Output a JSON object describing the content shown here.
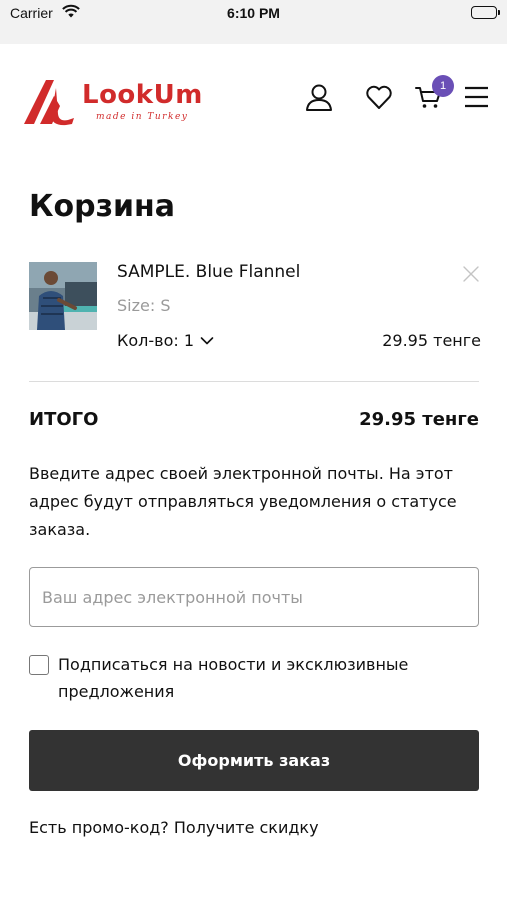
{
  "status_bar": {
    "carrier": "Carrier",
    "time": "6:10 PM"
  },
  "header": {
    "brand": "LookUm",
    "tagline": "made in Turkey",
    "brand_color": "#d12b2b",
    "cart_count": "1",
    "badge_color": "#6a4fb6",
    "icons": [
      "user-icon",
      "heart-icon",
      "cart-icon",
      "menu-icon"
    ]
  },
  "page": {
    "title": "Корзина"
  },
  "cart": {
    "items": [
      {
        "name": "SAMPLE. Blue Flannel",
        "size": "Size: S",
        "quantity": "Кол-во: 1",
        "price": "29.95 тенге"
      }
    ]
  },
  "summary": {
    "total_label": "ИТОГО",
    "total_value": "29.95 тенге"
  },
  "email": {
    "hint": "Введите адрес своей электронной почты. На этот адрес будут отправляться уведомления о статусе заказа.",
    "placeholder": "Ваш адрес электронной почты",
    "value": ""
  },
  "subscribe": {
    "label": "Подписаться на новости и эксклюзивные предложения",
    "checked": false
  },
  "actions": {
    "submit_label": "Оформить заказ",
    "submit_color": "#333333",
    "promo_label": "Есть промо-код? Получите скидку"
  }
}
